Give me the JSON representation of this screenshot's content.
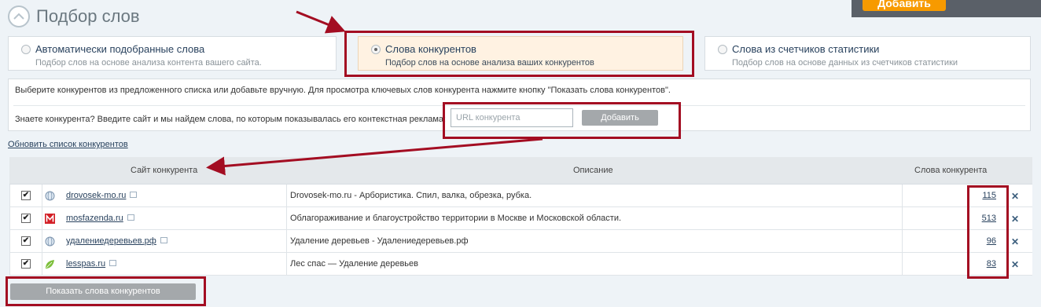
{
  "header": {
    "title": "Подбор слов"
  },
  "top_action": {
    "label": "Добавить"
  },
  "options": [
    {
      "title": "Автоматически подобранные слова",
      "subtitle": "Подбор слов на основе анализа контента вашего сайта.",
      "selected": false
    },
    {
      "title": "Слова конкурентов",
      "subtitle": "Подбор слов на основе анализа ваших конкурентов",
      "selected": true
    },
    {
      "title": "Слова из счетчиков статистики",
      "subtitle": "Подбор слов на основе данных из счетчиков статистики",
      "selected": false
    }
  ],
  "panel": {
    "instructions": "Выберите конкурентов из предложенного списка или добавьте вручную. Для просмотра ключевых слов конкурента нажмите кнопку \"Показать слова конкурентов\".",
    "ask_label": "Знаете конкурента? Введите сайт и мы найдем слова, по которым показывалась его контекстная реклама:",
    "url_placeholder": "URL конкурента",
    "add_label": "Добавить"
  },
  "refresh_link": "Обновить список конкурентов",
  "table": {
    "headers": {
      "site": "Сайт конкурента",
      "description": "Описание",
      "words": "Слова конкурента"
    },
    "rows": [
      {
        "checked": true,
        "favicon": "globe-icon",
        "site": "drovosek-mo.ru",
        "description": "Drovosek-mo.ru - Арбористика. Спил, валка, обрезка, рубка.",
        "count": "115"
      },
      {
        "checked": true,
        "favicon": "m-logo-icon",
        "site": "mosfazenda.ru",
        "description": "Облагораживание и благоустройство территории в Москве и Московской области.",
        "count": "513"
      },
      {
        "checked": true,
        "favicon": "globe-icon",
        "site": "удалениедеревьев.рф",
        "description": "Удаление деревьев - Удалениедеревьев.рф",
        "count": "96"
      },
      {
        "checked": true,
        "favicon": "leaf-icon",
        "site": "lesspas.ru",
        "description": "Лес спас — Удаление деревьев",
        "count": "83"
      }
    ]
  },
  "show_button": {
    "label": "Показать слова конкурентов"
  },
  "colors": {
    "highlight": "#a30d22",
    "accent_orange": "#f79a00",
    "link": "#29425e",
    "active_option_bg": "#fff2e2"
  }
}
